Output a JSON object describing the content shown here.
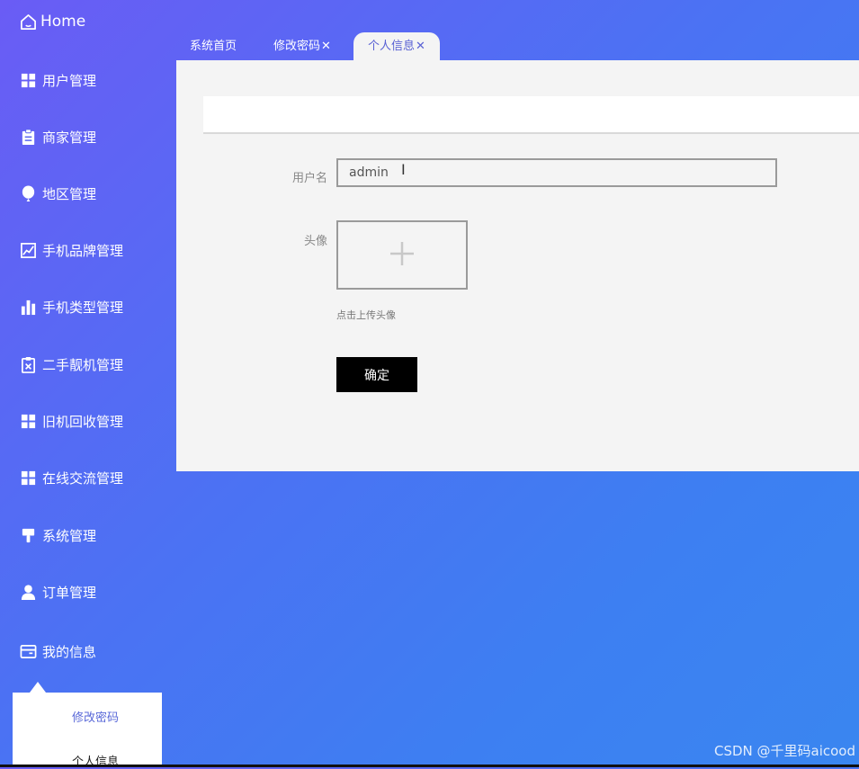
{
  "sidebar": {
    "home_label": "Home",
    "items": [
      {
        "label": "用户管理",
        "icon": "grid-icon"
      },
      {
        "label": "商家管理",
        "icon": "clipboard-icon"
      },
      {
        "label": "地区管理",
        "icon": "balloon-icon"
      },
      {
        "label": "手机品牌管理",
        "icon": "trend-chart-icon"
      },
      {
        "label": "手机类型管理",
        "icon": "bar-chart-icon"
      },
      {
        "label": "二手靓机管理",
        "icon": "clipboard-x-icon"
      },
      {
        "label": "旧机回收管理",
        "icon": "grid-icon"
      },
      {
        "label": "在线交流管理",
        "icon": "grid-icon"
      },
      {
        "label": "系统管理",
        "icon": "brush-icon"
      },
      {
        "label": "订单管理",
        "icon": "user-icon"
      },
      {
        "label": "我的信息",
        "icon": "wallet-icon"
      }
    ],
    "submenu": [
      "修改密码",
      "个人信息"
    ]
  },
  "tabs": [
    {
      "label": "系统首页",
      "closable": false
    },
    {
      "label": "修改密码",
      "closable": true
    },
    {
      "label": "个人信息",
      "closable": true,
      "active": true
    }
  ],
  "tab_close_glyph": "✕",
  "form": {
    "username_label": "用户名",
    "username_value": "admin",
    "avatar_label": "头像",
    "upload_hint": "点击上传头像",
    "confirm_label": "确定"
  },
  "watermark": "CSDN @千里码aicood",
  "colors": {
    "accent": "#5a62d4",
    "panel": "#f4f4f4",
    "button": "#000000"
  }
}
